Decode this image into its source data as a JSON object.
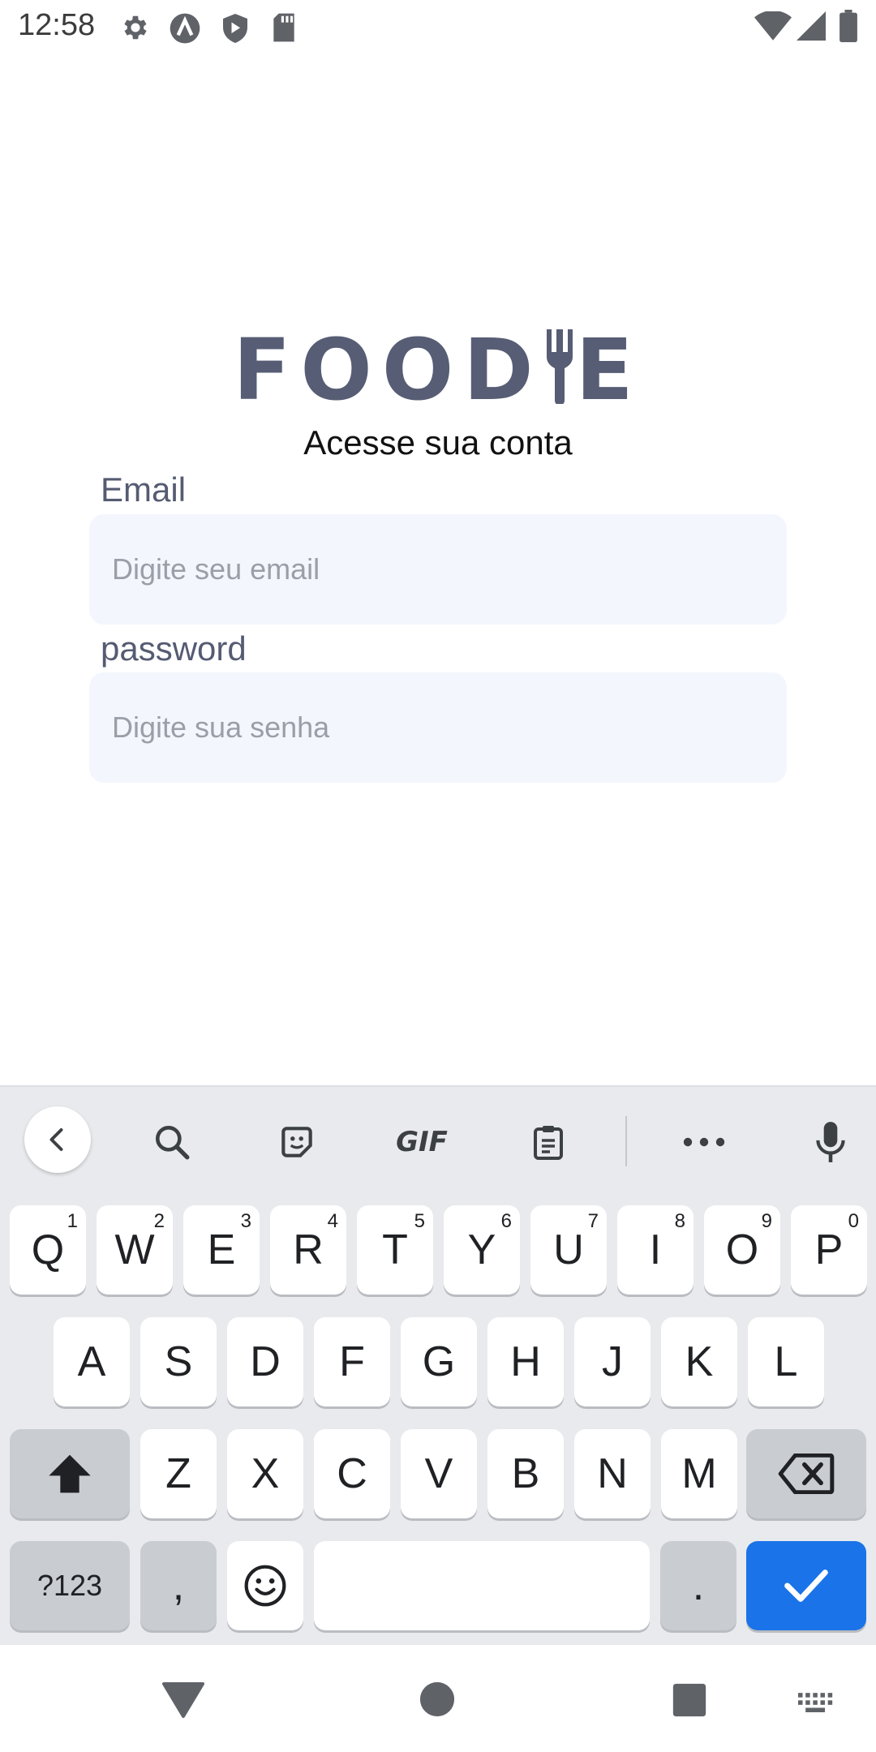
{
  "status_bar": {
    "time": "12:58",
    "left_icons": [
      "gear-icon",
      "a-logo-icon",
      "shield-play-icon",
      "sd-card-icon"
    ],
    "right_icons": [
      "wifi-icon",
      "signal-icon",
      "battery-icon"
    ]
  },
  "logo": {
    "text_left": "FOOD",
    "text_right": "E",
    "aria": "FOODIE"
  },
  "subtitle": "Acesse sua conta",
  "email": {
    "label": "Email",
    "placeholder": "Digite seu email",
    "value": ""
  },
  "password": {
    "label": "password",
    "placeholder": "Digite sua senha",
    "value": ""
  },
  "keyboard": {
    "toolbar": [
      "back-chevron-icon",
      "search-icon",
      "sticker-icon",
      "gif-icon",
      "clipboard-icon",
      "more-icon",
      "mic-icon"
    ],
    "gif_label": "GIF",
    "row1": [
      {
        "k": "Q",
        "h": "1"
      },
      {
        "k": "W",
        "h": "2"
      },
      {
        "k": "E",
        "h": "3"
      },
      {
        "k": "R",
        "h": "4"
      },
      {
        "k": "T",
        "h": "5"
      },
      {
        "k": "Y",
        "h": "6"
      },
      {
        "k": "U",
        "h": "7"
      },
      {
        "k": "I",
        "h": "8"
      },
      {
        "k": "O",
        "h": "9"
      },
      {
        "k": "P",
        "h": "0"
      }
    ],
    "row2": [
      "A",
      "S",
      "D",
      "F",
      "G",
      "H",
      "J",
      "K",
      "L"
    ],
    "row3": [
      "Z",
      "X",
      "C",
      "V",
      "B",
      "N",
      "M"
    ],
    "symbols_label": "?123",
    "comma": ",",
    "period": ".",
    "accent": "#1a73e8"
  },
  "nav_bar": [
    "back-triangle-icon",
    "home-circle-icon",
    "recents-square-icon",
    "keyboard-switch-icon"
  ]
}
